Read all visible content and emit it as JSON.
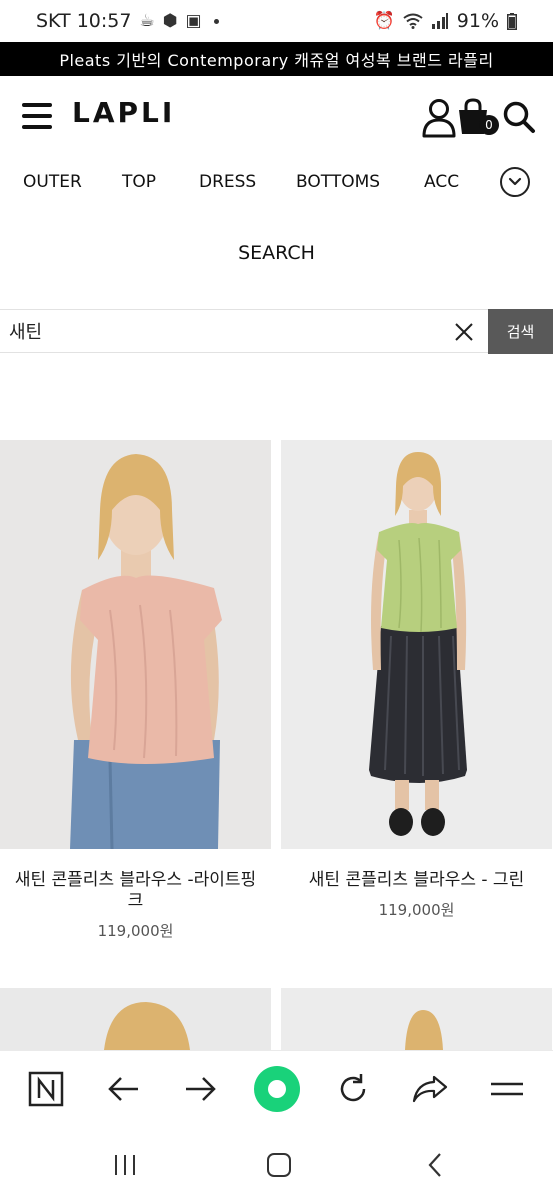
{
  "status_bar": {
    "time": "SKT 10:57",
    "battery": "91%"
  },
  "banner": {
    "text": "Pleats 기반의 Contemporary 캐쥬얼 여성복 브랜드 라플리"
  },
  "header": {
    "logo": "LAPLI",
    "cart_count": "0"
  },
  "categories": [
    "OUTER",
    "TOP",
    "DRESS",
    "BOTTOMS",
    "ACC"
  ],
  "search": {
    "title": "SEARCH",
    "query": "새틴",
    "button_label": "검색"
  },
  "products": [
    {
      "name_line1": "새틴 콘플리츠 블라우스 -라이트핑",
      "name_line2": "크",
      "price": "119,000원",
      "top_color": "#eab9a8"
    },
    {
      "name_line1": "새틴 콘플리츠 블라우스 - 그린",
      "name_line2": "",
      "price": "119,000원",
      "top_color": "#b7cf7e"
    }
  ],
  "colors": {
    "banner_bg": "#000000",
    "search_button_bg": "#595959",
    "browser_home": "#19d27a"
  },
  "icons": [
    "menu-icon",
    "user-icon",
    "cart-icon",
    "search-icon",
    "chevron-down-icon",
    "close-icon",
    "n-icon",
    "back-arrow-icon",
    "forward-arrow-icon",
    "refresh-icon",
    "share-icon",
    "menu-lines-icon"
  ]
}
